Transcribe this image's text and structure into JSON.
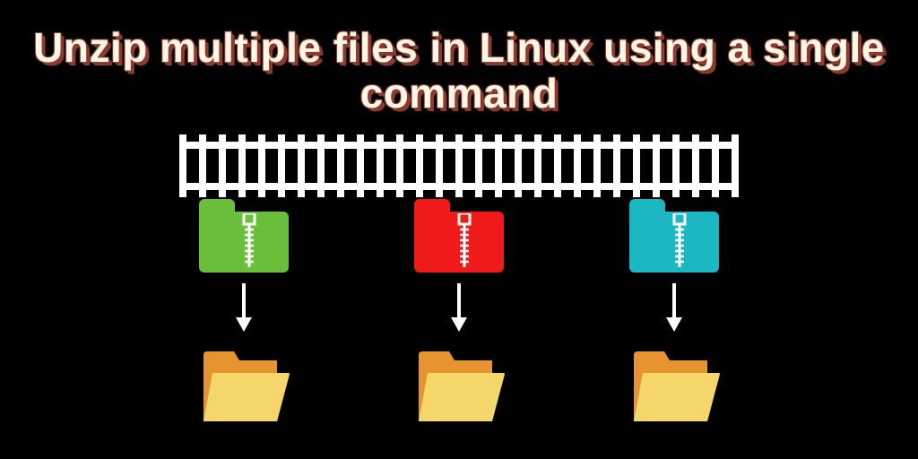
{
  "title": "Unzip multiple files in Linux using a single command",
  "zip_files": [
    {
      "name": "zip-file-green",
      "color": "#6abf3a"
    },
    {
      "name": "zip-file-red",
      "color": "#f01a1a"
    },
    {
      "name": "zip-file-cyan",
      "color": "#1bb8c4"
    }
  ],
  "arrow_color": "#ffffff",
  "folder_fill": "#f4d66a",
  "folder_edge": "#e5942f",
  "track_color": "#ffffff"
}
